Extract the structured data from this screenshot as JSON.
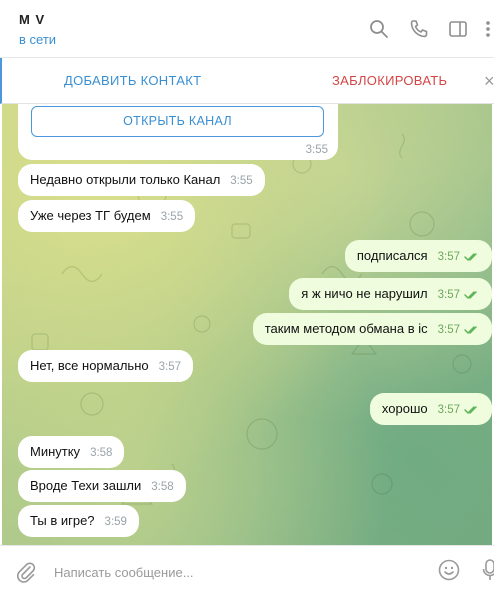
{
  "header": {
    "contact_name": "M V",
    "status": "в сети",
    "icons": [
      "search-icon",
      "phone-icon",
      "sidebar-panel-icon",
      "more-icon"
    ]
  },
  "actionbar": {
    "add_contact": "ДОБАВИТЬ КОНТАКТ",
    "block": "ЗАБЛОКИРОВАТЬ",
    "close": "×"
  },
  "chat": {
    "channel_card": {
      "button": "ОТКРЫТЬ КАНАЛ",
      "time": "3:55"
    },
    "messages": [
      {
        "dir": "in",
        "text": "Недавно открыли только Канал",
        "time": "3:55"
      },
      {
        "dir": "in",
        "text": "Уже через ТГ будем",
        "time": "3:55"
      },
      {
        "dir": "out",
        "text": "подписался",
        "time": "3:57"
      },
      {
        "dir": "out",
        "text": "я ж ничо не нарушил",
        "time": "3:57"
      },
      {
        "dir": "out",
        "text": "таким методом обмана в іс",
        "time": "3:57"
      },
      {
        "dir": "in",
        "text": "Нет, все нормально",
        "time": "3:57"
      },
      {
        "dir": "out",
        "text": "хорошо",
        "time": "3:57"
      },
      {
        "dir": "in",
        "text": "Минутку",
        "time": "3:58"
      },
      {
        "dir": "in",
        "text": "Вроде Техи зашли",
        "time": "3:58"
      },
      {
        "dir": "in",
        "text": "Ты в игре?",
        "time": "3:59"
      }
    ]
  },
  "composer": {
    "placeholder": "Написать сообщение..."
  },
  "colors": {
    "accent": "#3a8fd2",
    "danger": "#d44646",
    "outgoing_bubble": "#effdde",
    "read_check": "#5fb55a"
  }
}
